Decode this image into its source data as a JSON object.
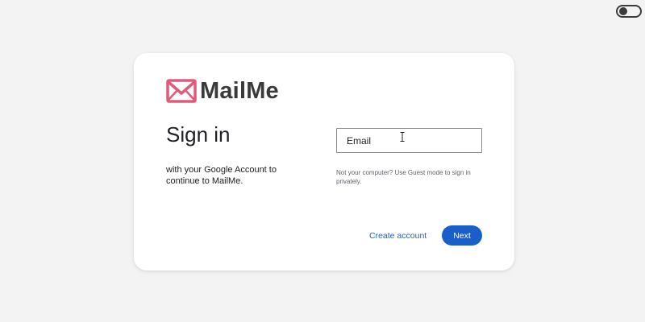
{
  "app": {
    "brand_name": "MailMe"
  },
  "signin": {
    "title": "Sign in",
    "subtitle": "with your Google Account to continue to MailMe.",
    "email_placeholder": "Email",
    "email_value": "",
    "guest_note": "Not your computer? Use Guest mode to sign in privately.",
    "create_account_label": "Create account",
    "next_label": "Next"
  },
  "theme_toggle": {
    "state": "off"
  },
  "colors": {
    "background": "#f3f3f4",
    "card": "#ffffff",
    "accent_blue": "#1a5fc9",
    "logo_pink": "#e05a7a",
    "text_dark": "#202124",
    "text_muted": "#5f6368"
  },
  "icons": {
    "logo": "envelope-icon",
    "text_cursor": "text-cursor-icon",
    "toggle": "toggle-switch-icon"
  }
}
